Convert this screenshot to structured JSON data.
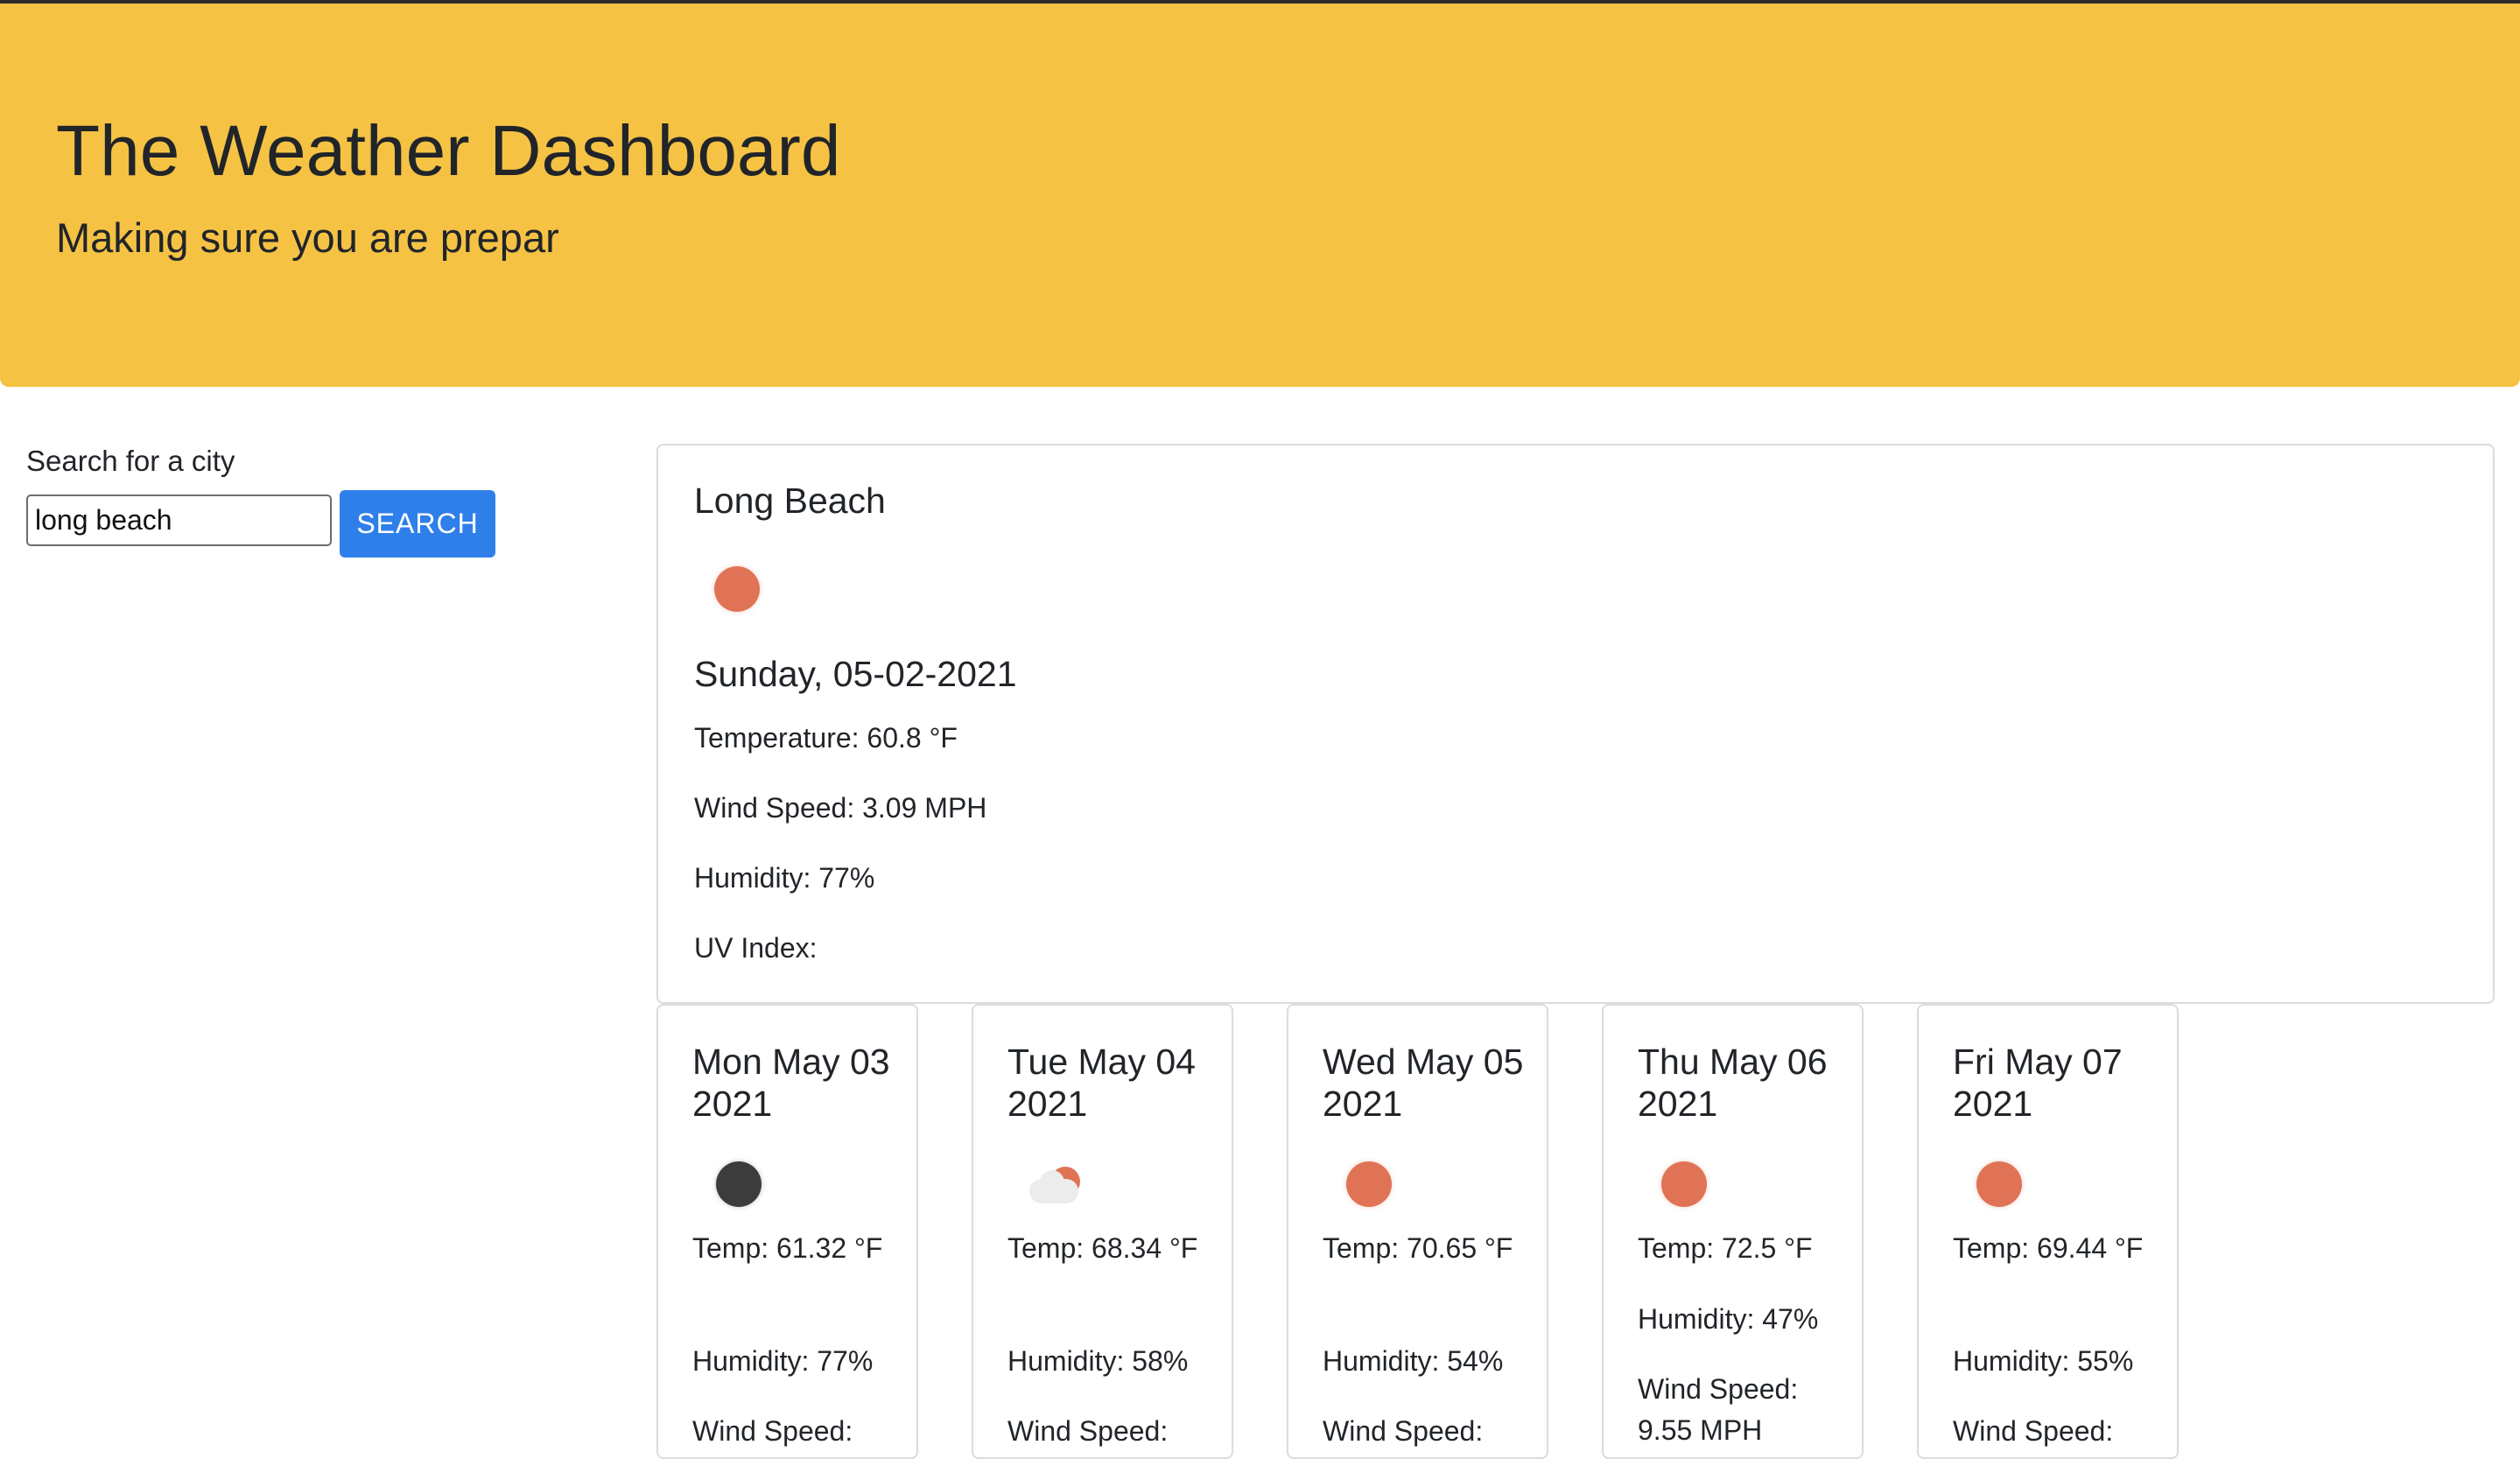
{
  "header": {
    "title": "The Weather Dashboard",
    "subtitle": "Making sure you are prepar"
  },
  "search": {
    "label": "Search for a city",
    "value": "long beach",
    "button_label": "SEARCH"
  },
  "current": {
    "city": "Long Beach",
    "icon": "sun-icon",
    "date": "Sunday, 05-02-2021",
    "temperature": "Temperature: 60.8 °F",
    "wind": "Wind Speed: 3.09 MPH",
    "humidity": "Humidity: 77%",
    "uv": "UV Index:"
  },
  "forecast": [
    {
      "date": "Mon May 03 2021",
      "icon": "moon-icon",
      "temp": "Temp: 61.32 °F",
      "humidity": "Humidity: 77%",
      "wind": "Wind Speed:"
    },
    {
      "date": "Tue May 04 2021",
      "icon": "partly-cloudy-icon",
      "temp": "Temp: 68.34 °F",
      "humidity": "Humidity: 58%",
      "wind": "Wind Speed:"
    },
    {
      "date": "Wed May 05 2021",
      "icon": "sun-icon",
      "temp": "Temp: 70.65 °F",
      "humidity": "Humidity: 54%",
      "wind": "Wind Speed:"
    },
    {
      "date": "Thu May 06 2021",
      "icon": "sun-icon",
      "temp": "Temp: 72.5 °F",
      "humidity": "Humidity: 47%",
      "wind": "Wind Speed: 9.55 MPH"
    },
    {
      "date": "Fri May 07 2021",
      "icon": "sun-icon",
      "temp": "Temp: 69.44 °F",
      "humidity": "Humidity: 55%",
      "wind": "Wind Speed:"
    }
  ],
  "colors": {
    "header_bg": "#f5c244",
    "button_bg": "#2f7fea",
    "sun": "#e07355"
  }
}
